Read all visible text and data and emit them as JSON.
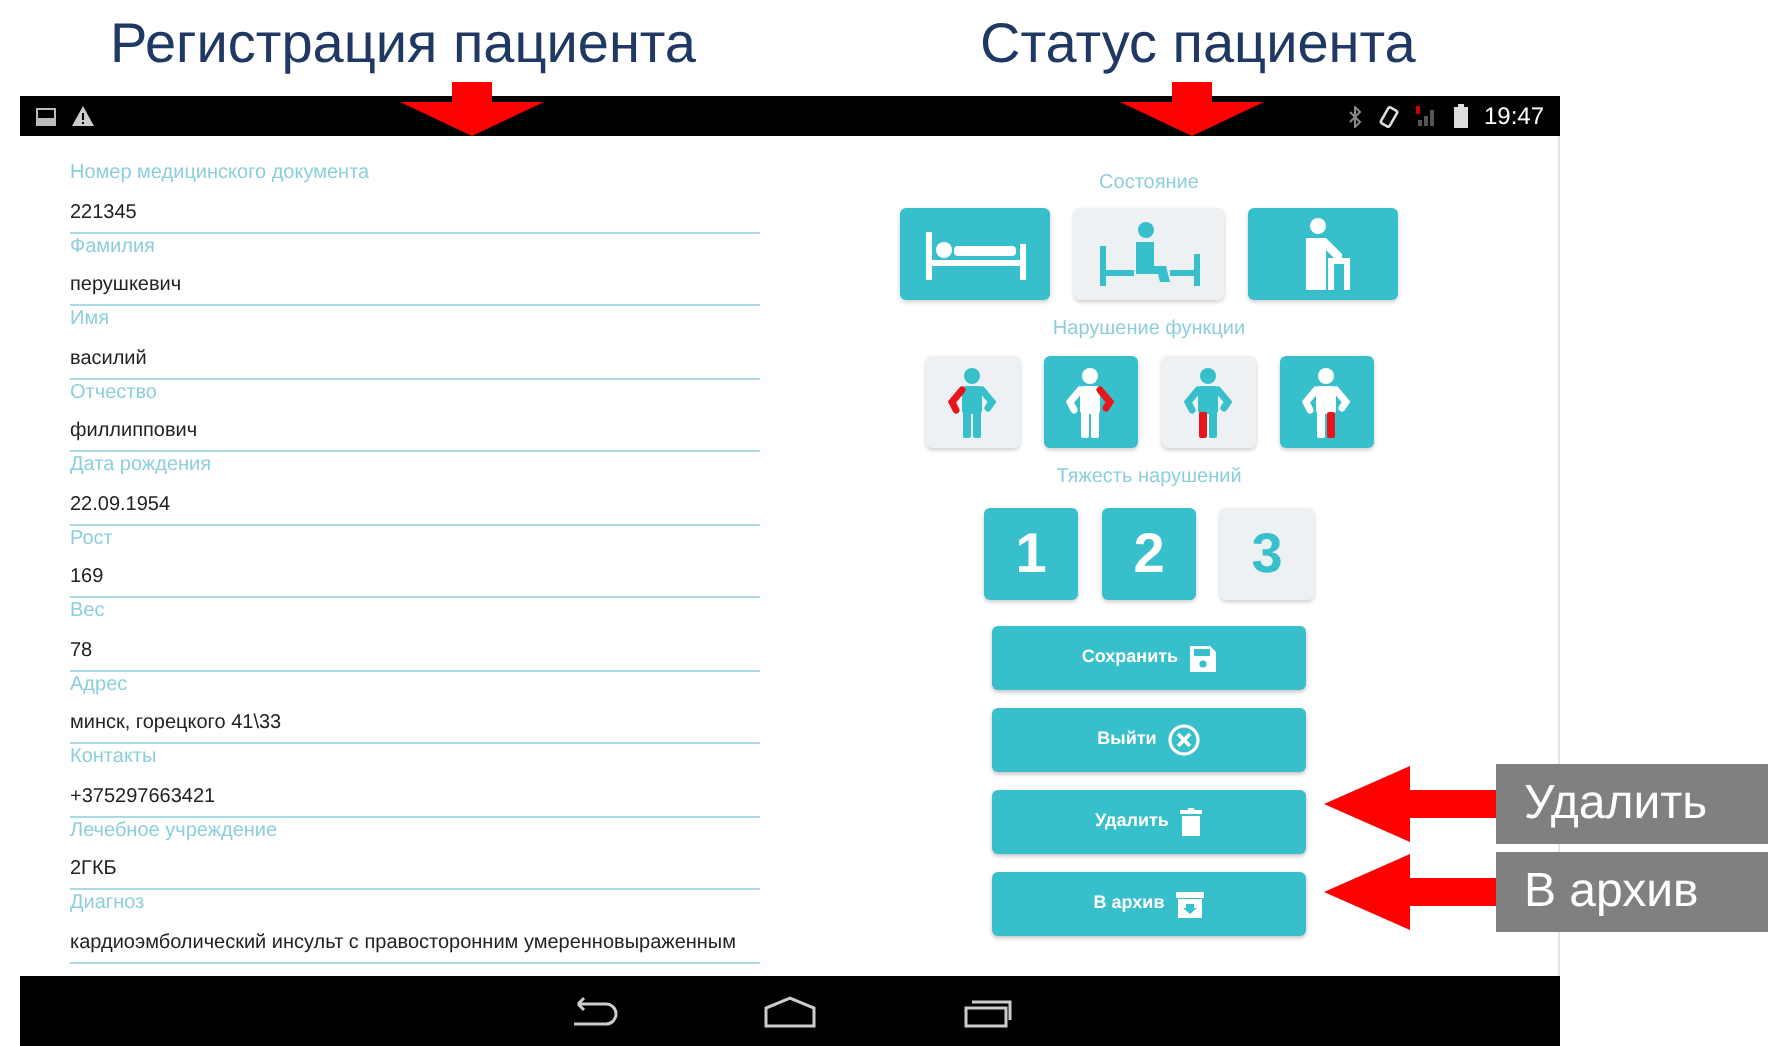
{
  "slide_titles": [
    "Регистрация пациента",
    "Статус пациента"
  ],
  "status_bar": {
    "time": "19:47"
  },
  "form": {
    "fields": [
      {
        "label": "Номер медицинского документа",
        "value": "221345"
      },
      {
        "label": "Фамилия",
        "value": "перушкевич"
      },
      {
        "label": "Имя",
        "value": "василий"
      },
      {
        "label": "Отчество",
        "value": "филлиппович"
      },
      {
        "label": "Дата рождения",
        "value": "22.09.1954"
      },
      {
        "label": "Рост",
        "value": "169"
      },
      {
        "label": "Вес",
        "value": "78"
      },
      {
        "label": "Адрес",
        "value": "минск, горецкого 41\\33"
      },
      {
        "label": "Контакты",
        "value": "+375297663421"
      },
      {
        "label": "Лечебное учреждение",
        "value": "2ГКБ"
      },
      {
        "label": "Диагноз",
        "value": "кардиоэмболический инсульт с правосторонним умеренновыраженным"
      }
    ]
  },
  "status": {
    "condition": {
      "label": "Состояние",
      "options": [
        {
          "kind": "lying",
          "selected": true
        },
        {
          "kind": "sitting",
          "selected": false
        },
        {
          "kind": "walker",
          "selected": true
        }
      ]
    },
    "function": {
      "label": "Нарушение функции",
      "options": [
        {
          "kind": "left_arm",
          "selected": false
        },
        {
          "kind": "right_arm",
          "selected": true
        },
        {
          "kind": "left_leg",
          "selected": false
        },
        {
          "kind": "right_leg",
          "selected": true
        }
      ]
    },
    "severity": {
      "label": "Тяжесть нарушений",
      "options": [
        {
          "label": "1",
          "selected": true
        },
        {
          "label": "2",
          "selected": true
        },
        {
          "label": "3",
          "selected": false
        }
      ]
    }
  },
  "buttons": [
    {
      "label": "Сохранить",
      "kind": "save"
    },
    {
      "label": "Выйти",
      "kind": "exit"
    },
    {
      "label": "Удалить",
      "kind": "delete"
    },
    {
      "label": "В архив",
      "kind": "archive"
    }
  ],
  "callouts": [
    {
      "text": "Удалить"
    },
    {
      "text": "В архив"
    }
  ]
}
